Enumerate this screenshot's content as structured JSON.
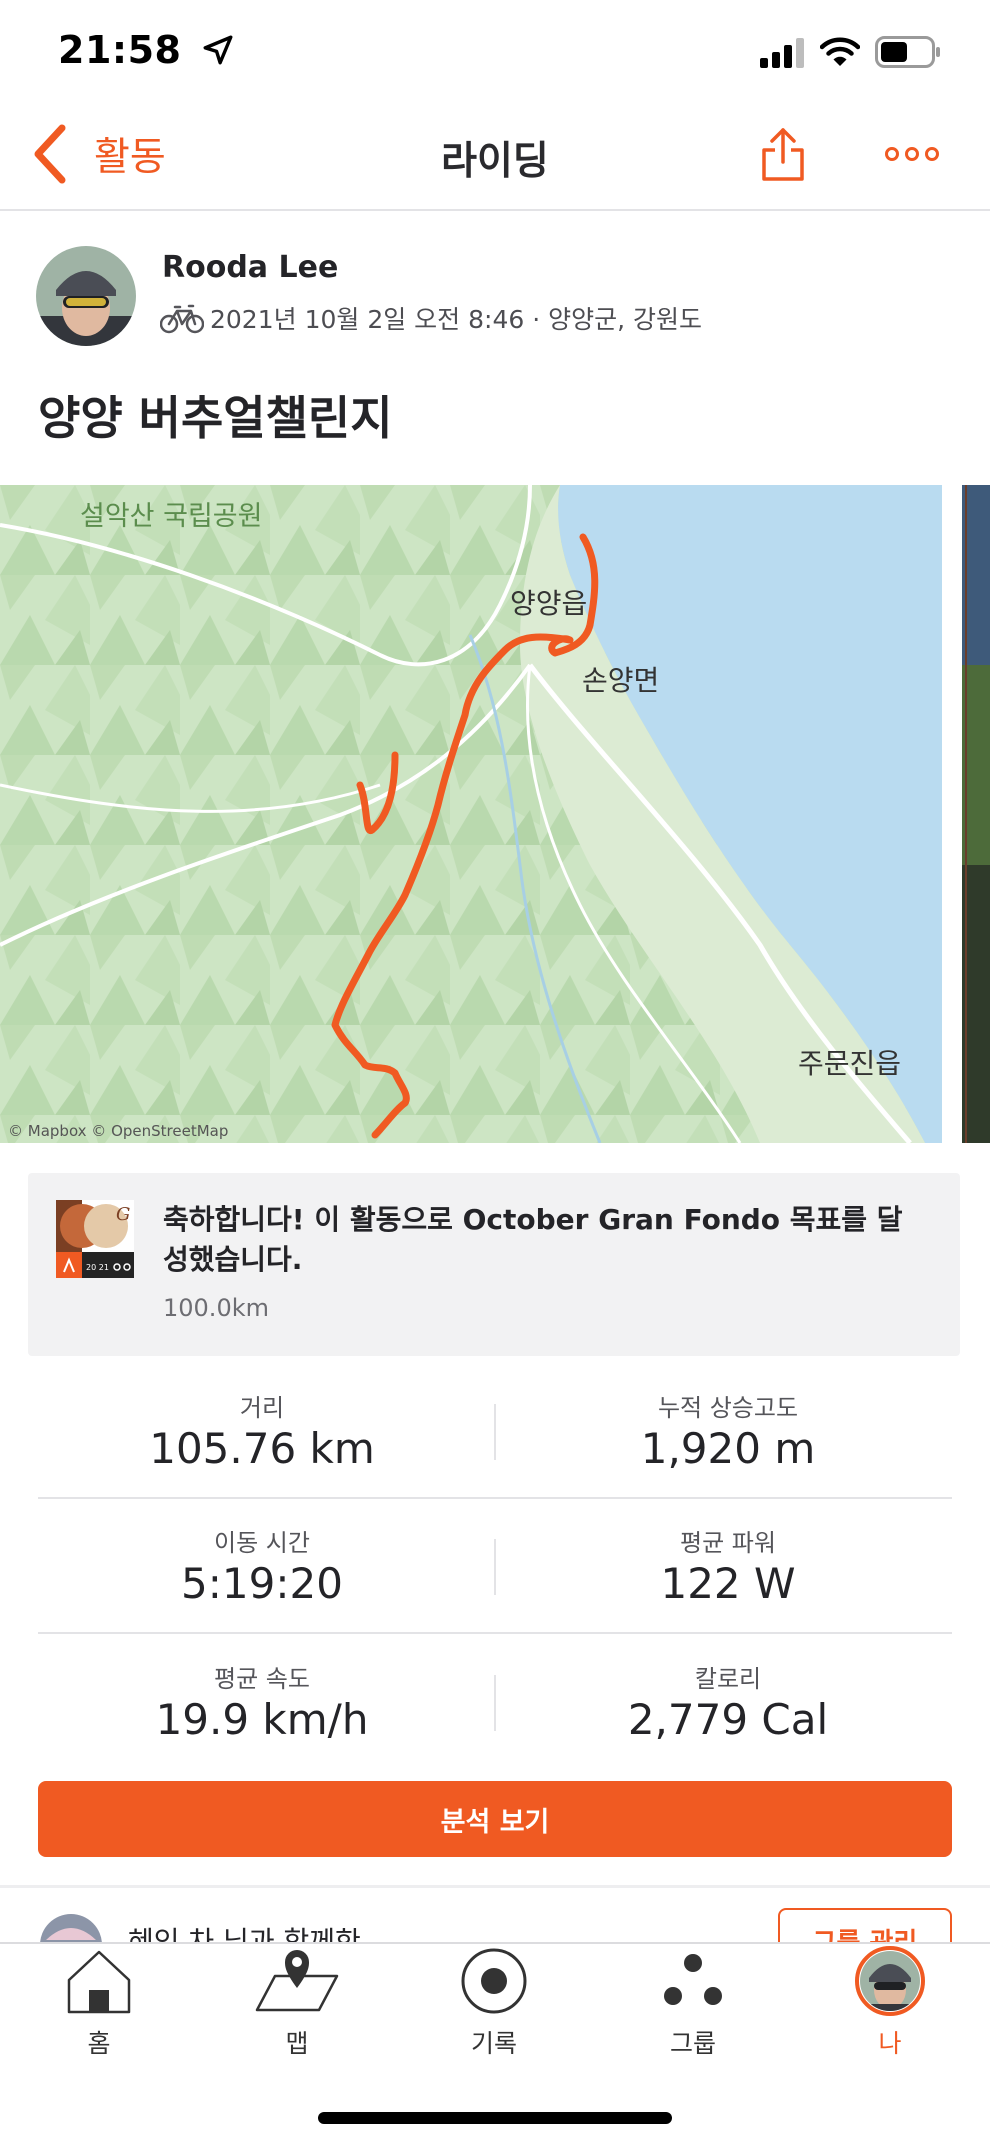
{
  "status_bar": {
    "time": "21:58"
  },
  "nav": {
    "back_label": "활동",
    "title": "라이딩"
  },
  "author": {
    "name": "Rooda Lee",
    "meta": "2021년 10월 2일 오전 8:46 · 양양군, 강원도"
  },
  "activity": {
    "title": "양양 버추얼챌린지"
  },
  "map": {
    "labels": {
      "park": "설악산 국립공원",
      "town1": "양양읍",
      "town2": "손양면",
      "town3": "주문진읍"
    },
    "attribution": "© Mapbox © OpenStreetMap",
    "colors": {
      "route": "#f05a22",
      "sea": "#b9dbf0",
      "land": "#cfe6c7"
    }
  },
  "goal": {
    "message": "축하합니다! 이 활동으로 October Gran Fondo 목표를 달성했습니다.",
    "distance": "100.0km"
  },
  "stats": [
    {
      "label": "거리",
      "value": "105.76 km"
    },
    {
      "label": "누적 상승고도",
      "value": "1,920 m"
    },
    {
      "label": "이동 시간",
      "value": "5:19:20"
    },
    {
      "label": "평균 파워",
      "value": "122 W"
    },
    {
      "label": "평균 속도",
      "value": "19.9 km/h"
    },
    {
      "label": "칼로리",
      "value": "2,779 Cal"
    }
  ],
  "analysis_button": "분석 보기",
  "next_feed": {
    "text": "혜인 차 님과 함께한",
    "group_button": "그룹 관리"
  },
  "tabs": [
    {
      "label": "홈",
      "icon": "home-icon"
    },
    {
      "label": "맵",
      "icon": "map-icon"
    },
    {
      "label": "기록",
      "icon": "record-icon"
    },
    {
      "label": "그룹",
      "icon": "groups-icon"
    },
    {
      "label": "나",
      "icon": "profile-avatar"
    }
  ],
  "accent_color": "#f05a22"
}
